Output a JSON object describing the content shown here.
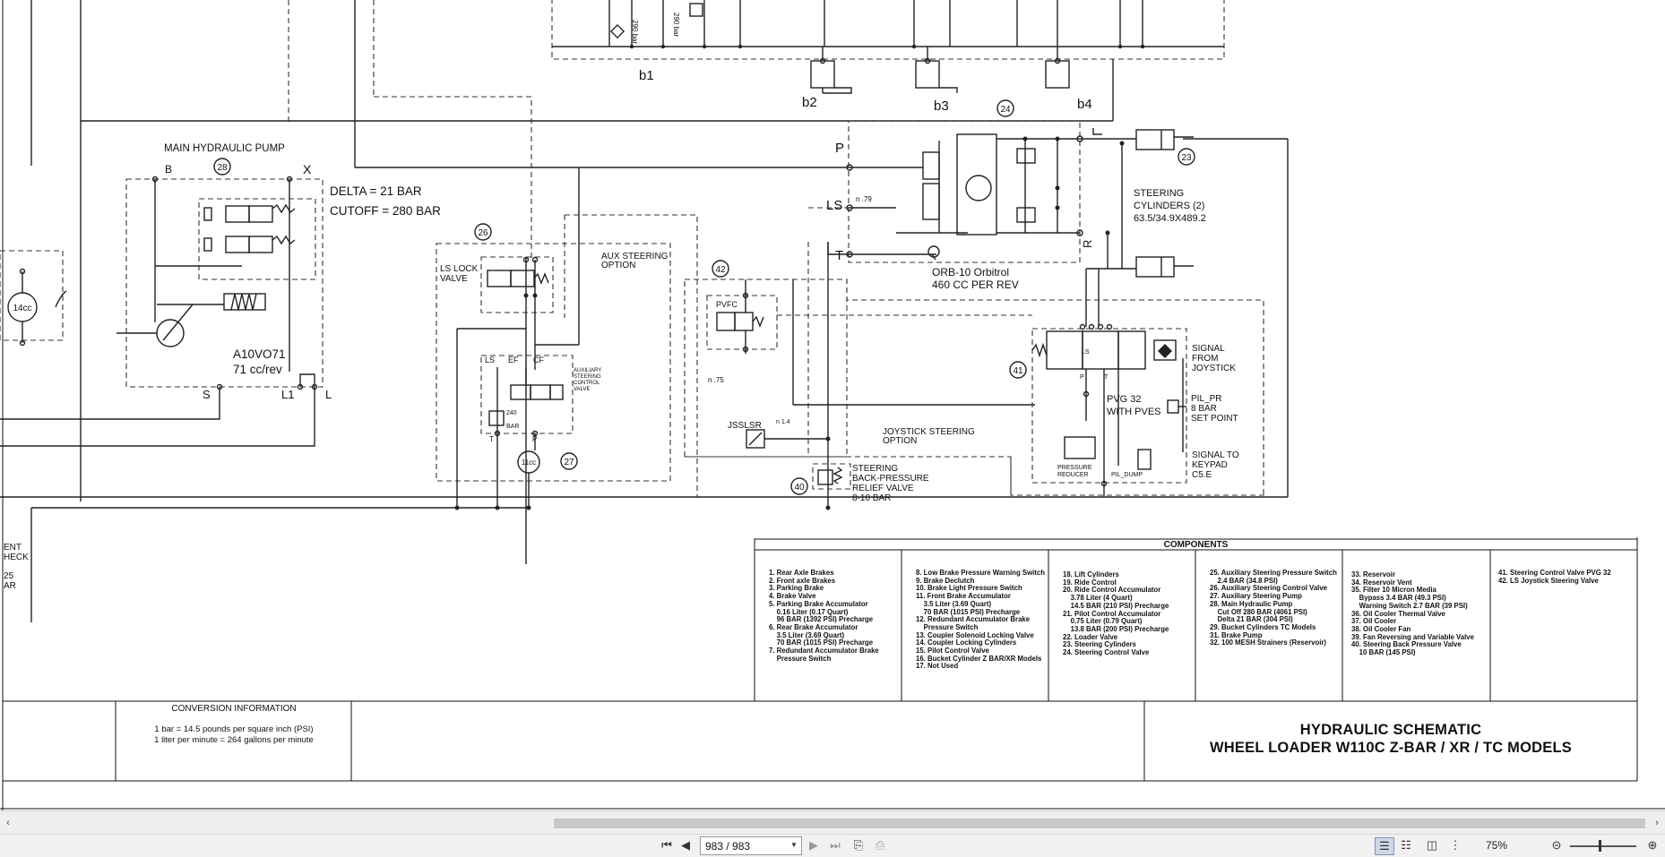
{
  "schematic": {
    "pump_label": "MAIN HYDRAULIC PUMP",
    "port_b": "B",
    "port_x": "X",
    "port_s": "S",
    "port_l1": "L1",
    "port_l": "L",
    "delta": "DELTA = 21 BAR",
    "cutoff": "CUTOFF = 280 BAR",
    "pump_model": "A10VO71",
    "pump_disp": "71 cc/rev",
    "pump_14cc": "14cc",
    "pump_11cc": "11cc",
    "ls_lock": [
      "LS LOCK",
      "VALVE"
    ],
    "aux_steering": [
      "AUX STEERING",
      "OPTION"
    ],
    "aux_ctrl_valve": [
      "AUXILIARY",
      "STEERING",
      "CONTROL",
      "VALVE"
    ],
    "port_ls": "LS",
    "port_ef": "EF",
    "port_cf": "CF",
    "port_p": "P",
    "port_t": "T",
    "port_r": "R",
    "bar_240": "240",
    "bar_unit": "BAR",
    "pvfc": "PVFC",
    "n75": "n .75",
    "n79": "n .79",
    "n14": "n 1.4",
    "jsslsr": "JSSLSR",
    "joystick_opt": [
      "JOYSTICK STEERING",
      "OPTION"
    ],
    "orbitrol": [
      "ORB-10 Orbitrol",
      "460 CC PER REV"
    ],
    "steer_cyl": [
      "STEERING",
      "CYLINDERS (2)",
      "63.5/34.9X489.2"
    ],
    "signal_joy": [
      "SIGNAL",
      "FROM",
      "JOYSTICK"
    ],
    "pvg": [
      "PVG 32",
      "WITH PVES"
    ],
    "pil_pr": [
      "PIL_PR",
      "8 BAR",
      "SET POINT"
    ],
    "signal_keypad": [
      "SIGNAL TO",
      "KEYPAD",
      "C5.E"
    ],
    "pressure_reducer": [
      "PRESSURE",
      "REDUCER"
    ],
    "pil_dump": "PIL_DUMP",
    "backpressure": [
      "STEERING",
      "BACK-PRESSURE",
      "RELIEF VALVE",
      "8-10 BAR"
    ],
    "b_labels": [
      "b1",
      "b2",
      "b3",
      "b4"
    ],
    "relief_290": "290 bar",
    "cut_left": [
      "ENT",
      "HECK",
      "25",
      "AR"
    ],
    "callouts": [
      "28",
      "26",
      "42",
      "24",
      "23",
      "41",
      "40",
      "27"
    ]
  },
  "components": {
    "title": "COMPONENTS",
    "col1": [
      "1. Rear Axle Brakes",
      "2. Front axle Brakes",
      "3. Parking Brake",
      "4. Brake Valve",
      "5. Parking Brake Accumulator",
      "    0.16 Liter (0.17 Quart)",
      "    96 BAR (1392 PSI) Precharge",
      "6. Rear Brake Accumulator",
      "    3.5 Liter (3.69 Quart)",
      "    70 BAR (1015 PSI) Precharge",
      "7. Redundant Accumulator Brake",
      "    Pressure Switch"
    ],
    "col2": [
      "8. Low Brake Pressure Warning Switch",
      "9. Brake Declutch",
      "10. Brake Light Pressure Switch",
      "11. Front Brake Accumulator",
      "    3.5 Liter (3.69 Quart)",
      "    70 BAR (1015 PSI) Precharge",
      "12. Redundant Accumulator Brake",
      "    Pressure Switch",
      "13. Coupler Solenoid Locking Valve",
      "14. Coupler Locking Cylinders",
      "15. Pilot Control Valve",
      "16. Bucket Cylinder Z BAR/XR Models",
      "17. Not Used"
    ],
    "col3": [
      "18. Lift Cylinders",
      "19. Ride Control",
      "20. Ride Control Accumulator",
      "    3.78 Liter (4 Quart)",
      "    14.5 BAR (210 PSI) Precharge",
      "21. Pilot Control Accumulator",
      "    0.75 Liter (0.79 Quart)",
      "    13.8 BAR (200 PSI) Precharge",
      "22. Loader Valve",
      "23. Steering Cylinders",
      "24. Steering Control Valve"
    ],
    "col4": [
      "25. Auxiliary Steering Pressure Switch",
      "    2.4 BAR (34.8 PSI)",
      "26. Auxiliary Steering Control Valve",
      "27. Auxiliary Steering Pump",
      "28. Main Hydraulic Pump",
      "    Cut Off 280 BAR (4061 PSI)",
      "    Delta 21 BAR (304 PSI)",
      "29. Bucket Cylinders TC Models",
      "31. Brake Pump",
      "32. 100 MESH Strainers (Reservoir)"
    ],
    "col5": [
      "33. Reservoir",
      "34. Reservoir Vent",
      "35. Filter 10 Micron Media",
      "    Bypass 3.4 BAR (49.3 PSI)",
      "    Warning Switch 2.7 BAR (39 PSI)",
      "36. Oil Cooler Thermal Valve",
      "37. Oil Cooler",
      "38. Oil Cooler Fan",
      "39. Fan Reversing and Variable Valve",
      "40. Steering Back Pressure Valve",
      "    10 BAR (145 PSI)"
    ],
    "col6": [
      "41. Steering Control Valve PVG 32",
      "42. LS Joystick Steering Valve"
    ]
  },
  "conversion": {
    "title": "CONVERSION INFORMATION",
    "line1": "1 bar = 14.5 pounds per square inch (PSI)",
    "line2": "1 liter per minute = 264 gallons per minute"
  },
  "title_block": {
    "line1": "HYDRAULIC SCHEMATIC",
    "line2": "WHEEL LOADER W110C Z-BAR / XR / TC MODELS"
  },
  "toolbar": {
    "page_value": "983 / 983",
    "zoom": "75%",
    "icons": [
      "first-page-icon",
      "prev-page-icon",
      "next-page-icon",
      "last-page-icon",
      "copy-icon",
      "paste-icon",
      "single-page-view-icon",
      "continuous-view-icon",
      "two-page-view-icon",
      "thumbnails-view-icon",
      "zoom-out-icon",
      "zoom-in-icon"
    ]
  }
}
